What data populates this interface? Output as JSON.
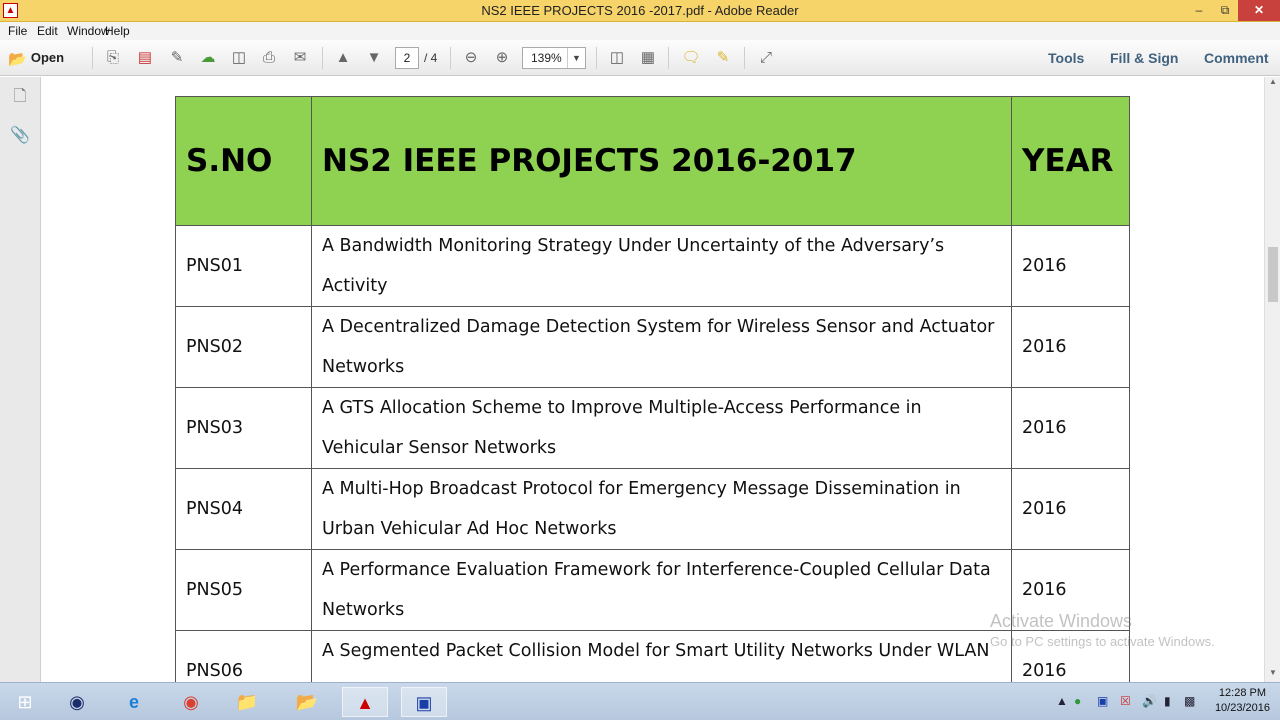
{
  "window": {
    "title": "NS2 IEEE PROJECTS 2016 -2017.pdf - Adobe Reader",
    "minimize": "–",
    "restore": "⧉",
    "close": "✕"
  },
  "menu": [
    "File",
    "Edit",
    "Window",
    "Help"
  ],
  "toolbar": {
    "open_label": "Open",
    "page_current": "2",
    "page_total": "/ 4",
    "zoom": "139%",
    "tools": "Tools",
    "fill_sign": "Fill & Sign",
    "comment": "Comment"
  },
  "table": {
    "headers": [
      "S.NO",
      "NS2 IEEE PROJECTS 2016-2017",
      "YEAR"
    ],
    "rows": [
      {
        "sno": "PNS01",
        "title": "A Bandwidth Monitoring Strategy Under Uncertainty of the Adversary’s Activity",
        "year": "2016"
      },
      {
        "sno": "PNS02",
        "title": "A Decentralized Damage Detection System for Wireless Sensor and Actuator Networks",
        "year": "2016"
      },
      {
        "sno": "PNS03",
        "title": "A GTS Allocation Scheme to Improve Multiple-Access Performance in Vehicular Sensor Networks",
        "year": "2016"
      },
      {
        "sno": "PNS04",
        "title": "A Multi-Hop Broadcast Protocol for Emergency Message Dissemination in Urban Vehicular Ad Hoc Networks",
        "year": "2016"
      },
      {
        "sno": "PNS05",
        "title": "A Performance Evaluation Framework for Interference-Coupled Cellular Data Networks",
        "year": "2016"
      },
      {
        "sno": "PNS06",
        "title": "A Segmented Packet Collision Model for Smart Utility Networks Under WLAN Interference",
        "year": "2016"
      }
    ]
  },
  "watermark": {
    "line1": "Activate Windows",
    "line2": "Go to PC settings to activate Windows."
  },
  "taskbar": {
    "clock_time": "12:28 PM",
    "clock_date": "10/23/2016"
  }
}
